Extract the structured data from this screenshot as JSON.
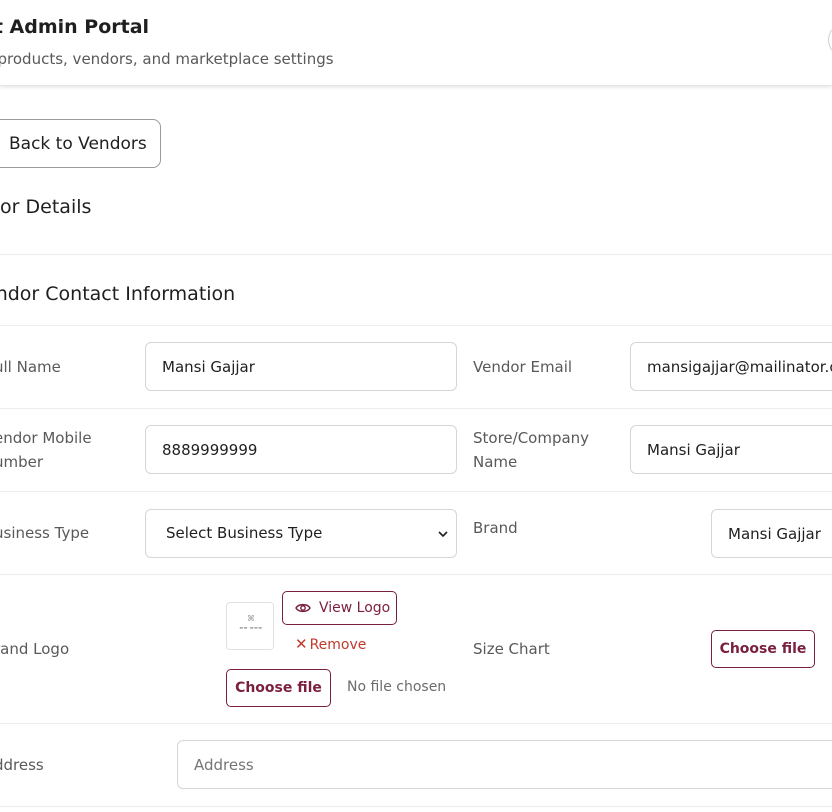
{
  "header": {
    "title": "ist Admin Portal",
    "subtitle": "ge products, vendors, and marketplace settings"
  },
  "back_button": {
    "label": "Back to Vendors"
  },
  "section": {
    "heading": "dor Details"
  },
  "card": {
    "title": "endor Contact Information"
  },
  "fields": {
    "full_name": {
      "label": "ull Name",
      "value": "Mansi Gajjar"
    },
    "vendor_email": {
      "label": "Vendor Email",
      "value": "mansigajjar@mailinator.co"
    },
    "mobile": {
      "label_line1": "endor Mobile",
      "label_line2": "umber",
      "value": "8889999999"
    },
    "store": {
      "label_line1": "Store/Company",
      "label_line2": "Name",
      "value": "Mansi Gajjar"
    },
    "business_type": {
      "label": "usiness Type",
      "selected": "Select Business Type"
    },
    "brand": {
      "label": "Brand",
      "value": "Mansi Gajjar"
    },
    "brand_logo": {
      "label": "rand Logo",
      "view_label": "View Logo",
      "remove_label": "Remove",
      "choose_label": "Choose file",
      "no_file": "No file chosen"
    },
    "size_chart": {
      "label": "Size Chart",
      "choose_label": "Choose file"
    },
    "address": {
      "label": "ddress",
      "placeholder": "Address"
    }
  },
  "colors": {
    "accent": "#7a1f3d",
    "remove": "#c0392b"
  },
  "icons": [
    "eye-icon",
    "close-icon",
    "chevron-down-icon"
  ]
}
